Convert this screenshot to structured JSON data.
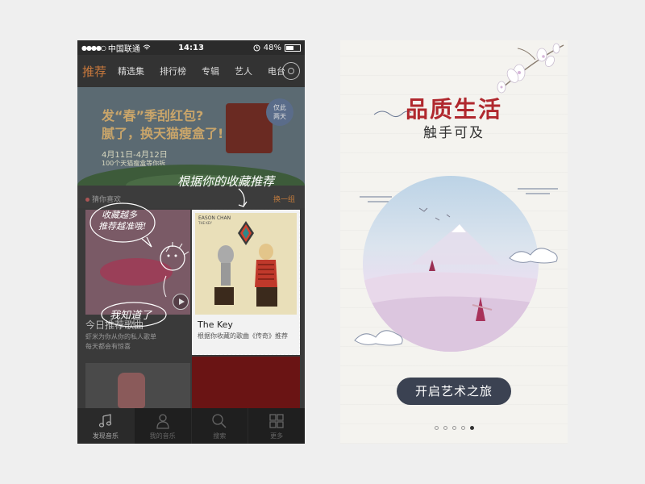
{
  "left_phone": {
    "status_bar": {
      "signal": "●●●●○",
      "carrier": "中国联通",
      "time": "14:13",
      "battery": "48%"
    },
    "nav": {
      "tabs": [
        {
          "label": "推荐",
          "active": true
        },
        {
          "label": "精选集"
        },
        {
          "label": "排行榜"
        },
        {
          "label": "专辑"
        },
        {
          "label": "艺人"
        },
        {
          "label": "电台"
        }
      ],
      "disc_icon": "disc-icon"
    },
    "banner": {
      "line1": "发“春”季刮红包?",
      "line2": "腻了，换天猫瘦盒了!",
      "date": "4月11日-4月12日",
      "sub": "100个天猫瘦盒等你拆",
      "badge_line1": "仅此",
      "badge_line2": "两天"
    },
    "section": {
      "title": "猜你喜欢",
      "change": "换一组"
    },
    "card_left": {
      "title": "今日推荐歌曲",
      "desc1": "虾米为你从你的私人歌单",
      "desc2": "每天都会有惊喜"
    },
    "card_right": {
      "artist": "EASON CHAN",
      "album_sub": "THE KEY",
      "title": "The Key",
      "desc": "根据你收藏的歌曲《传奇》推荐"
    },
    "annotations": {
      "top": "根据你的收藏推荐",
      "bubble_line1": "收藏越多",
      "bubble_line2": "推荐越准哦!",
      "know": "我知道了"
    },
    "tab_bar": [
      {
        "label": "发现音乐",
        "icon": "music-note-icon"
      },
      {
        "label": "我的音乐",
        "icon": "user-icon"
      },
      {
        "label": "搜索",
        "icon": "search-icon"
      },
      {
        "label": "更多",
        "icon": "grid-icon"
      }
    ]
  },
  "right_phone": {
    "title": "品质生活",
    "subtitle": "触手可及",
    "cta": "开启艺术之旅",
    "pager": {
      "count": 5,
      "active_index": 4
    }
  },
  "colors": {
    "accent_orange": "#c8783c",
    "title_red": "#b0282e",
    "cta_bg": "#3b4252"
  }
}
